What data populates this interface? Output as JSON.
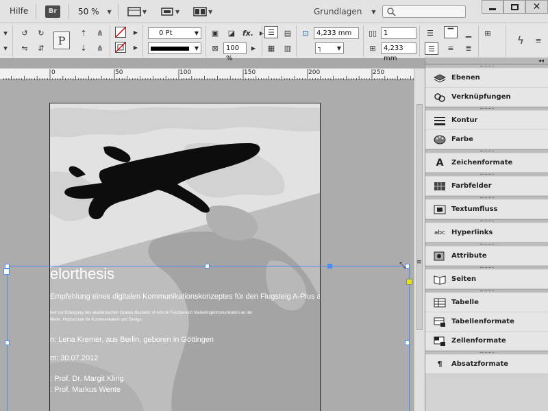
{
  "menubar": {
    "help": "Hilfe",
    "bridge": "Br",
    "zoom": "50 %",
    "workspace": "Grundlagen",
    "search_placeholder": ""
  },
  "control": {
    "stroke_weight": "0 Pt",
    "scale": "100 %",
    "width": "4,233 mm",
    "height": "4,233 mm",
    "columns": "1",
    "fx": "fx."
  },
  "ruler": {
    "ticks": [
      "0",
      "50",
      "100",
      "150",
      "200",
      "250"
    ]
  },
  "document": {
    "title_fragment": "elorthesis",
    "subtitle": "Empfehlung eines digitalen Kommunikationskonzeptes für den Flugsteig A-Plus an",
    "small_line1": "beit zur Erlangung des akademischen Grades Bachelor of Arts im Fochbereich Marketingkommunikation an der",
    "small_line2": "Berlin, Hochschule für Kommunikation und Design.",
    "author_line": "n: Lena Kremer, aus Berlin, geboren in Göttingen",
    "date_line": "m: 30.07.2012",
    "prof1": ": Prof. Dr. Margit Kling",
    "prof2": ": Prof. Markus Wente"
  },
  "panel": {
    "collapse": "◂◂",
    "items": [
      "Ebenen",
      "Verknüpfungen",
      "Kontur",
      "Farbe",
      "Zeichenformate",
      "Farbfelder",
      "Textumfluss",
      "Hyperlinks",
      "Attribute",
      "Seiten",
      "Tabelle",
      "Tabellenformate",
      "Zellenformate",
      "Absatzformate"
    ]
  },
  "colors": {
    "selection": "#4a8cf0",
    "frame_anchor": "#e8e800"
  }
}
